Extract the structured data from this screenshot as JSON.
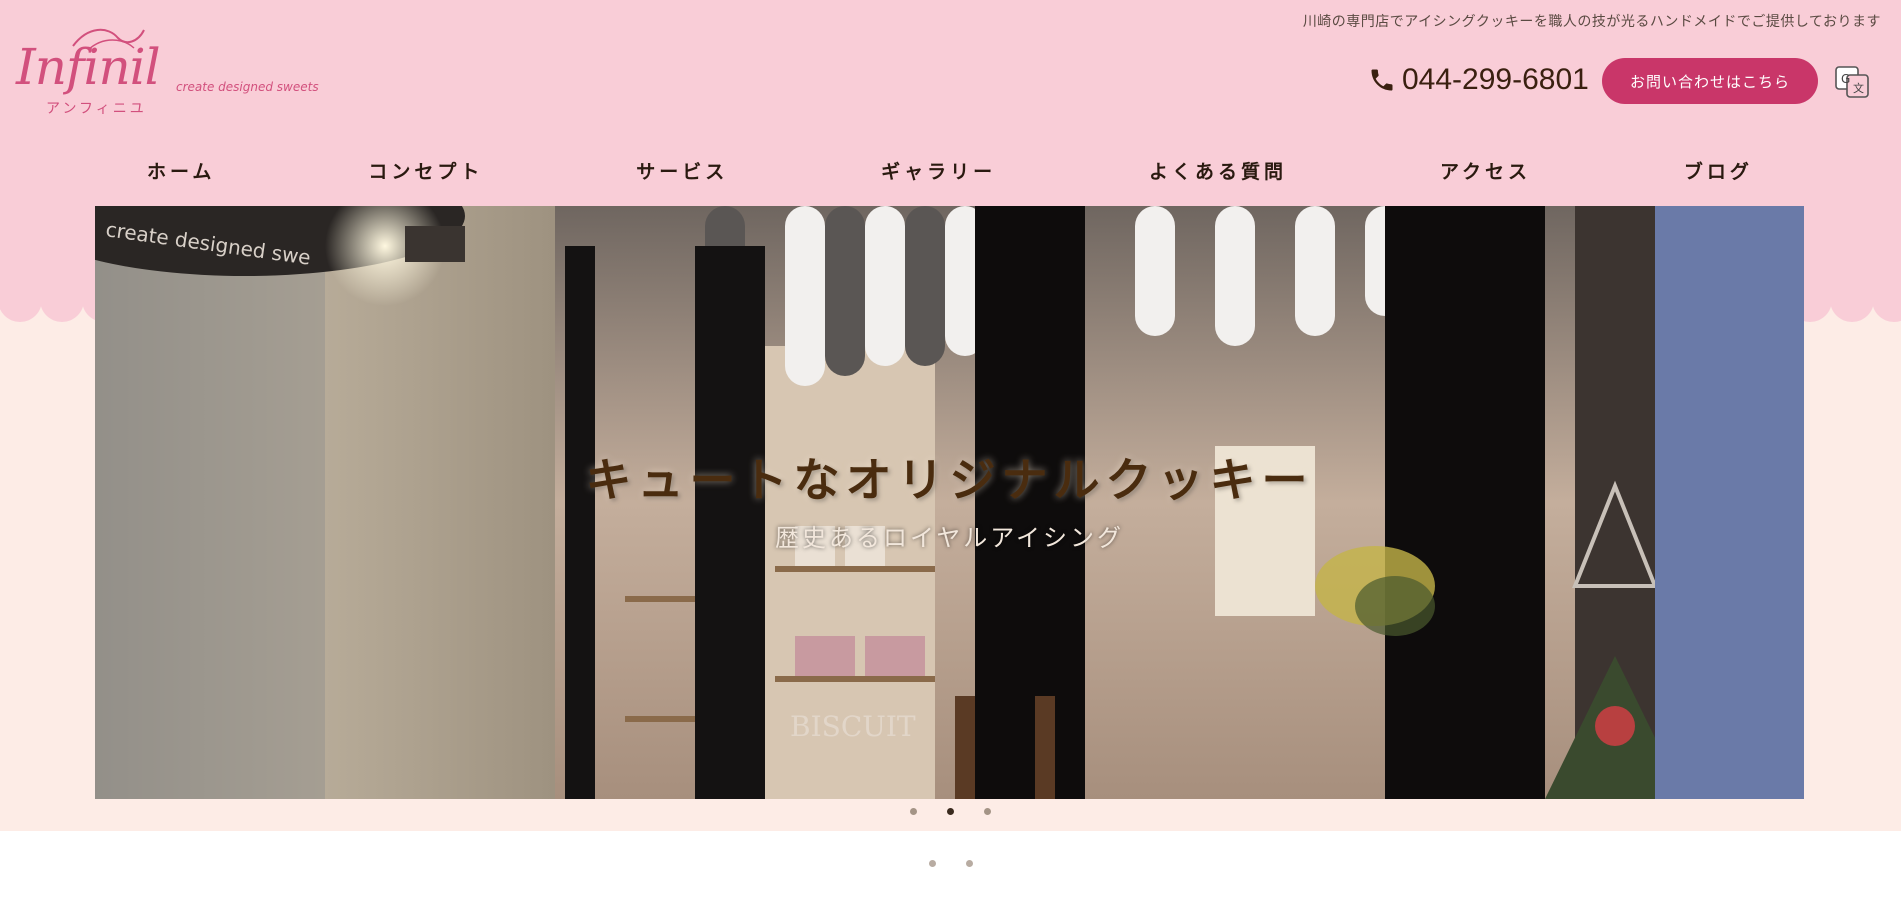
{
  "header": {
    "tagline": "川崎の専門店でアイシングクッキーを職人の技が光るハンドメイドでご提供しております",
    "logo": {
      "script": "Infinil",
      "subtitle": "create designed sweets",
      "kana": "アンフィニユ"
    },
    "phone": {
      "icon": "phone-icon",
      "number": "044-299-6801"
    },
    "contact_button": "お問い合わせはこちら",
    "translate_icon": "google-translate-icon"
  },
  "nav": {
    "items": [
      {
        "label": "ホーム"
      },
      {
        "label": "コンセプト"
      },
      {
        "label": "サービス"
      },
      {
        "label": "ギャラリー"
      },
      {
        "label": "よくある質問"
      },
      {
        "label": "アクセス"
      },
      {
        "label": "ブログ"
      }
    ]
  },
  "hero": {
    "title": "キュートなオリジナルクッキー",
    "subtitle": "歴史あるロイヤルアイシング",
    "sign_text": "create designed swe",
    "window_text": "BISCUIT",
    "slide_count": 3,
    "active_slide": 2
  },
  "colors": {
    "header_pink": "#f9cdd7",
    "cream": "#fdece6",
    "accent": "#c93669",
    "logo": "#d2507d",
    "nav_text": "#2a1a10"
  }
}
